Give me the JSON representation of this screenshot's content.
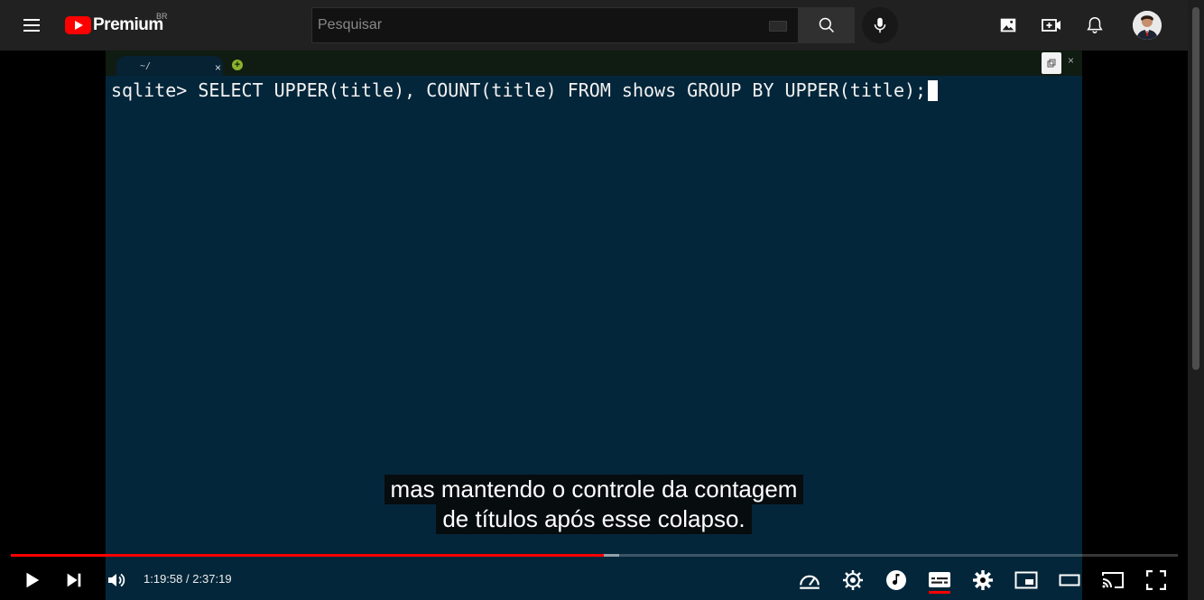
{
  "header": {
    "logo_text": "Premium",
    "country_code": "BR",
    "search_placeholder": "Pesquisar"
  },
  "terminal": {
    "tab_title": "~/",
    "tab_close": "×",
    "add_tab": "+",
    "close": "×",
    "command_line": "sqlite> SELECT UPPER(title), COUNT(title) FROM shows GROUP BY UPPER(title);"
  },
  "subtitles": {
    "line1": "mas mantendo o controle da contagem",
    "line2": "de títulos após esse colapso."
  },
  "player": {
    "current_time": "1:19:58",
    "duration": "2:37:19",
    "time_display": "1:19:58 / 2:37:19",
    "played_fraction": 0.508,
    "buffered_fraction": 0.521,
    "accent_color": "#ff0000"
  },
  "icons": [
    "menu-icon",
    "youtube-logo-icon",
    "keyboard-icon",
    "search-icon",
    "mic-icon",
    "image-icon",
    "create-video-icon",
    "bell-icon",
    "avatar",
    "play-icon",
    "next-icon",
    "volume-icon",
    "speed-icon",
    "autoplay-settings-icon",
    "music-icon",
    "subtitles-icon",
    "settings-gear-icon",
    "miniplayer-icon",
    "theater-mode-icon",
    "cast-icon",
    "fullscreen-icon"
  ]
}
